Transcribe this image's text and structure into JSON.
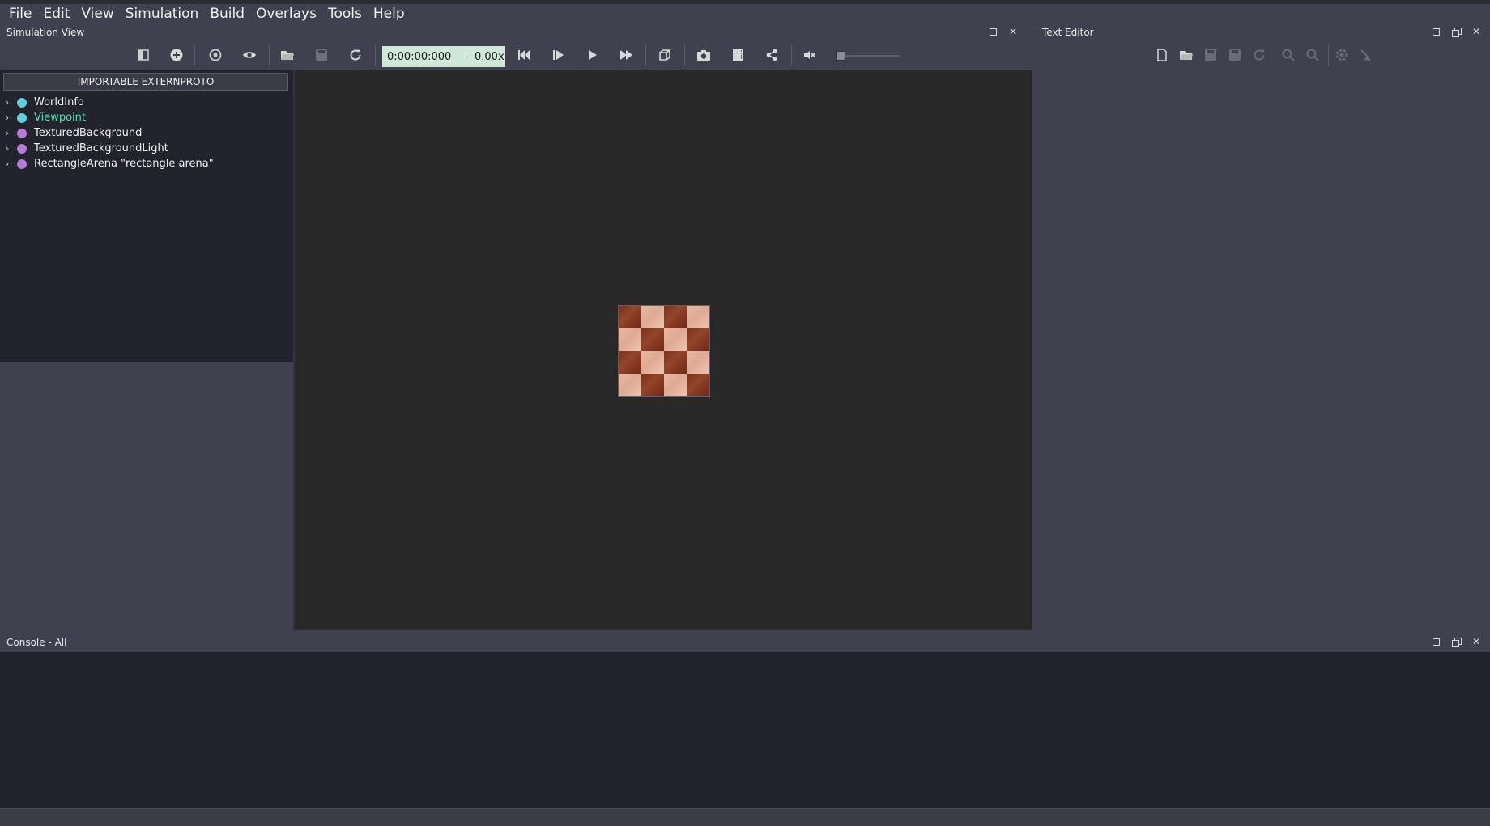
{
  "menubar": {
    "items": [
      {
        "mnemonic": "F",
        "rest": "ile"
      },
      {
        "mnemonic": "E",
        "rest": "dit"
      },
      {
        "mnemonic": "V",
        "rest": "iew"
      },
      {
        "mnemonic": "S",
        "rest": "imulation"
      },
      {
        "mnemonic": "B",
        "rest": "uild"
      },
      {
        "mnemonic": "O",
        "rest": "verlays"
      },
      {
        "mnemonic": "T",
        "rest": "ools"
      },
      {
        "mnemonic": "H",
        "rest": "elp"
      }
    ]
  },
  "simulation_view": {
    "title": "Simulation View",
    "time": "0:00:00:000",
    "separator": "-",
    "speed": "0.00x",
    "volume_level": 0
  },
  "scene_tree": {
    "header": "IMPORTABLE EXTERNPROTO",
    "items": [
      {
        "label": "WorldInfo",
        "color": "#5fd0d6",
        "selected": false
      },
      {
        "label": "Viewpoint",
        "color": "#5fd0d6",
        "selected": true
      },
      {
        "label": "TexturedBackground",
        "color": "#b77ad9",
        "selected": false
      },
      {
        "label": "TexturedBackgroundLight",
        "color": "#b77ad9",
        "selected": false
      },
      {
        "label": "RectangleArena \"rectangle arena\"",
        "color": "#b77ad9",
        "selected": false
      }
    ]
  },
  "text_editor": {
    "title": "Text Editor"
  },
  "console": {
    "title": "Console - All"
  },
  "colors": {
    "accent_selected": "#4fe3b6",
    "time_box": "#cfe8d8",
    "board_dark": "#7c2f1c",
    "board_light": "#e9b9a3"
  }
}
